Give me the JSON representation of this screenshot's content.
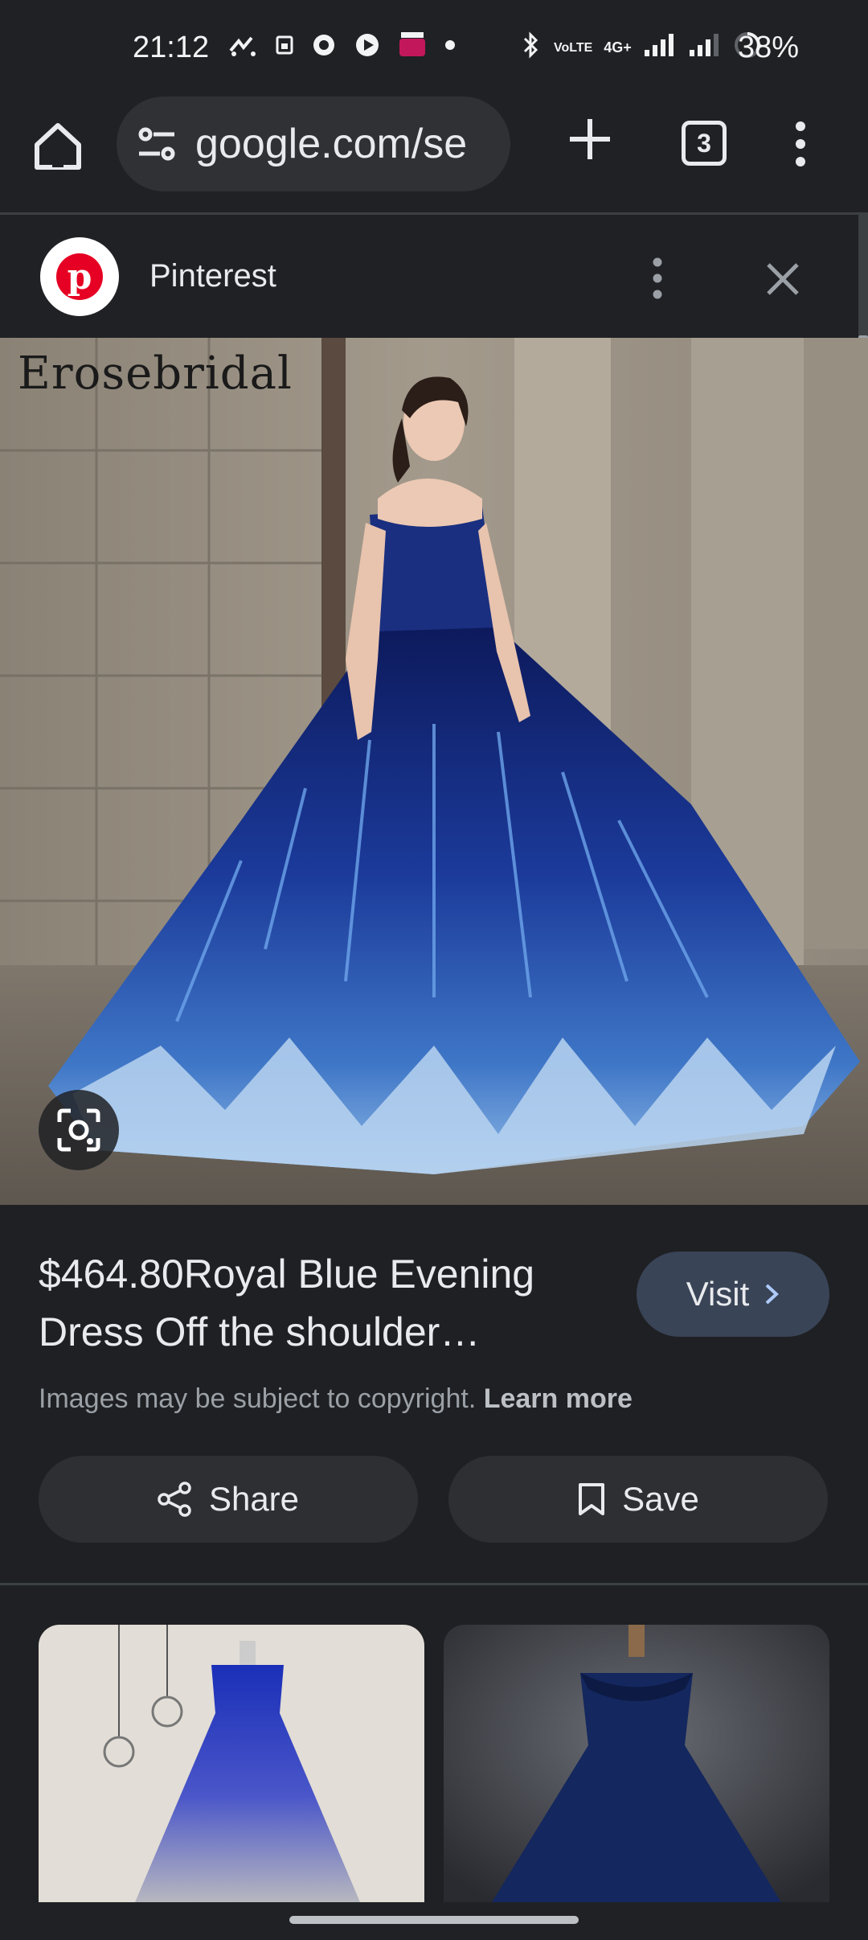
{
  "status_bar": {
    "time": "21:12",
    "battery": "38%",
    "net_label": "4G+",
    "volte_label": "VoLTE"
  },
  "browser": {
    "url": "google.com/se",
    "tab_count": "3"
  },
  "source": {
    "name": "Pinterest"
  },
  "image": {
    "watermark": "Erosebridal"
  },
  "result": {
    "title": "$464.80Royal Blue Evening Dress Off the shoulder…",
    "visit_label": "Visit",
    "copyright_text": "Images may be subject to copyright.",
    "learn_more": "Learn more",
    "share_label": "Share",
    "save_label": "Save"
  }
}
